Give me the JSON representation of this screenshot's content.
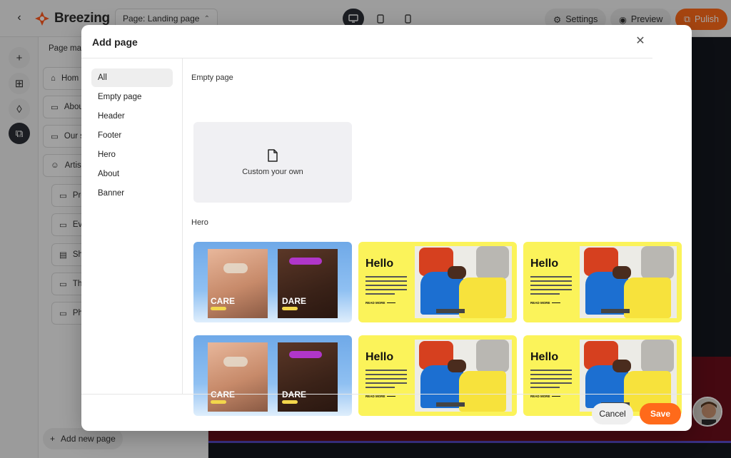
{
  "app": {
    "brand": "Breezing",
    "page_select": "Page: Landing page",
    "settings_label": "Settings",
    "preview_label": "Preview",
    "publish_label": "Pulish",
    "accent_color": "#ff6a1a"
  },
  "page_manager": {
    "title": "Page man",
    "items": [
      "Hom",
      "Abou",
      "Our s",
      "Artis",
      "Pro",
      "Ev",
      "Sh",
      "Th",
      "Ph"
    ],
    "add_new_page": "Add new page"
  },
  "modal": {
    "title": "Add page",
    "categories": [
      "All",
      "Empty page",
      "Header",
      "Footer",
      "Hero",
      "About",
      "Banner"
    ],
    "selected_category": "All",
    "sections": {
      "empty": {
        "label": "Empty page",
        "custom_label": "Custom your own"
      },
      "hero": {
        "label": "Hero",
        "templates": [
          {
            "type": "care-dare",
            "left_text": "CARE",
            "right_text": "DARE"
          },
          {
            "type": "hello",
            "title": "Hello",
            "read_more": "READ MORE"
          },
          {
            "type": "hello",
            "title": "Hello",
            "read_more": "READ MORE"
          },
          {
            "type": "care-dare",
            "left_text": "CARE",
            "right_text": "DARE"
          },
          {
            "type": "hello",
            "title": "Hello",
            "read_more": "READ MORE"
          },
          {
            "type": "hello",
            "title": "Hello",
            "read_more": "READ MORE"
          }
        ]
      }
    },
    "cancel_label": "Cancel",
    "save_label": "Save"
  }
}
